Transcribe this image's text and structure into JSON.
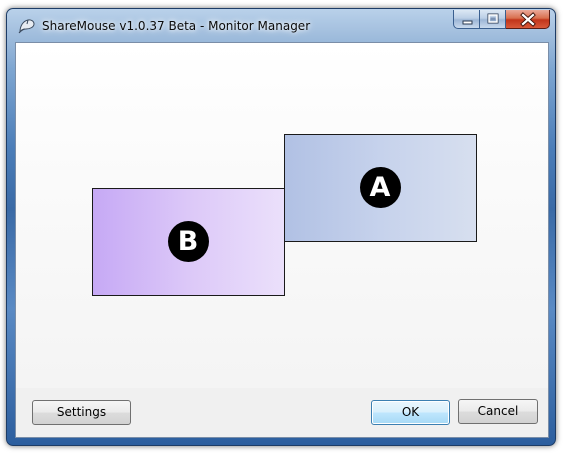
{
  "window": {
    "title": "ShareMouse v1.0.37 Beta - Monitor Manager",
    "app_icon": "sharemouse-mouse-icon",
    "caption_icons": [
      "minimize-icon",
      "maximize-icon",
      "close-icon"
    ]
  },
  "monitors": [
    {
      "label": "A",
      "color_left": "#b1c1e4",
      "color_right": "#d7dfef"
    },
    {
      "label": "B",
      "color_left": "#c6a9f5",
      "color_right": "#ebe0fb"
    }
  ],
  "buttons": {
    "settings": "Settings",
    "ok": "OK",
    "cancel": "Cancel"
  },
  "colors": {
    "frame_accent": "#4b7db8",
    "close_button": "#c2351b",
    "default_button_border": "#3c7fb1"
  }
}
